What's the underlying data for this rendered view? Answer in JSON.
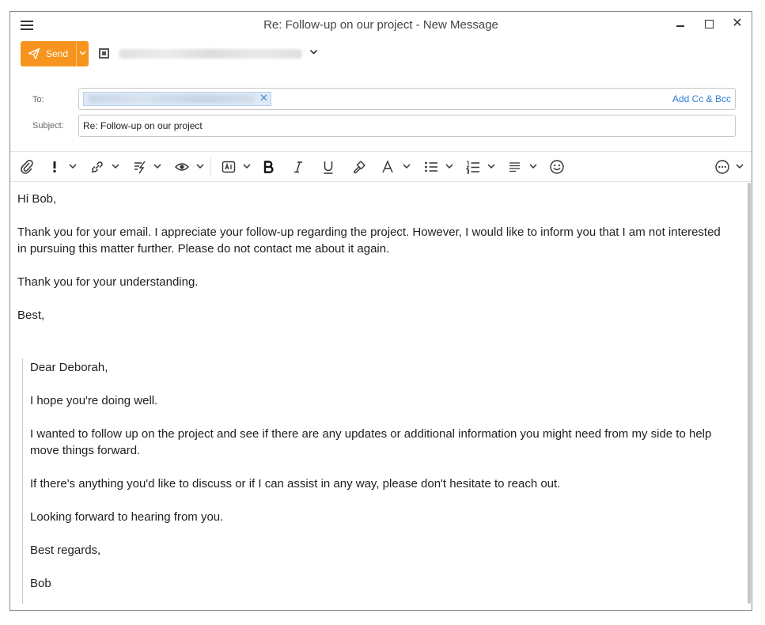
{
  "window": {
    "title": "Re: Follow-up on our project - New Message"
  },
  "toolbar_top": {
    "send_label": "Send"
  },
  "header": {
    "to_label": "To:",
    "subject_label": "Subject:",
    "add_cc_bcc": "Add Cc & Bcc",
    "subject_value": "Re: Follow-up on our project"
  },
  "format_toolbar": {
    "icons": [
      "paperclip-icon",
      "importance-icon",
      "link-icon",
      "signature-icon",
      "eye-icon",
      "text-box-icon",
      "bold-icon",
      "italic-icon",
      "underline-icon",
      "format-painter-icon",
      "font-icon",
      "bulleted-list-icon",
      "numbered-list-icon",
      "align-icon",
      "emoji-icon",
      "more-options-icon"
    ]
  },
  "reply": {
    "greeting": "Hi Bob,",
    "para1": "Thank you for your email. I appreciate your follow-up regarding the project. However, I would like to inform you that I am not interested in pursuing this matter further. Please do not contact me about it again.",
    "para2": "Thank you for your understanding.",
    "closing": "Best,"
  },
  "quoted": {
    "greeting": "Dear Deborah,",
    "para1": "I hope you're doing well.",
    "para2": "I wanted to follow up on the project and see if there are any updates or additional information you might need from my side to help move things forward.",
    "para3": "If there's anything you'd like to discuss or if I can assist in any way, please don't hesitate to reach out.",
    "para4": "Looking forward to hearing from you.",
    "closing": "Best regards,",
    "signature": "Bob"
  },
  "colors": {
    "accent": "#f7941d",
    "link": "#2f7fd8",
    "chip": "#dde9f7"
  }
}
